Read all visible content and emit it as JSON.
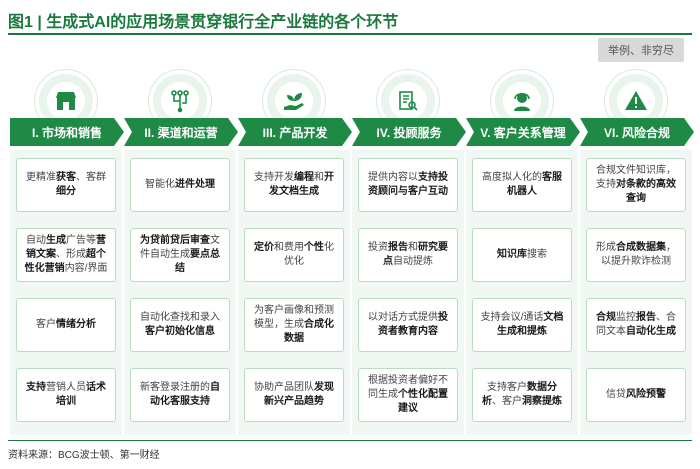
{
  "title": "图1 | 生成式AI的应用场景贯穿银行全产业链的各个环节",
  "badge": "举例、非穷尽",
  "source": "资料来源：BCG波士顿、第一财经",
  "colors": {
    "green": "#1e8a46",
    "light": "#f1f7f2",
    "border": "#b9dcc3"
  },
  "columns": [
    {
      "label": "I. 市场和销售",
      "icon": "store-icon",
      "cells": [
        [
          {
            "t": "更精准"
          },
          {
            "t": "获客",
            "b": true
          },
          {
            "t": "、客群"
          },
          {
            "t": "细分",
            "b": true
          }
        ],
        [
          {
            "t": "自动"
          },
          {
            "t": "生成",
            "b": true
          },
          {
            "t": "广告等"
          },
          {
            "t": "营销文案",
            "b": true
          },
          {
            "t": "、形成"
          },
          {
            "t": "超个性化营销",
            "b": true
          },
          {
            "t": "内容/界面"
          }
        ],
        [
          {
            "t": "客户"
          },
          {
            "t": "情绪分析",
            "b": true
          }
        ],
        [
          {
            "t": "支持",
            "b": true
          },
          {
            "t": "营销人员"
          },
          {
            "t": "话术培训",
            "b": true
          }
        ]
      ]
    },
    {
      "label": "II. 渠道和运营",
      "icon": "circuit-icon",
      "cells": [
        [
          {
            "t": "智能化"
          },
          {
            "t": "进件处理",
            "b": true
          }
        ],
        [
          {
            "t": "为",
            "b": true
          },
          {
            "t": "贷前贷后审查",
            "b": true
          },
          {
            "t": "文件自动生成"
          },
          {
            "t": "要点总结",
            "b": true
          }
        ],
        [
          {
            "t": "自动化查找和录入"
          },
          {
            "t": "客户初始化信息",
            "b": true
          }
        ],
        [
          {
            "t": "新客登录注册的"
          },
          {
            "t": "自动化客服支持",
            "b": true
          }
        ]
      ]
    },
    {
      "label": "III. 产品开发",
      "icon": "plant-hand-icon",
      "cells": [
        [
          {
            "t": "支持开发"
          },
          {
            "t": "编程",
            "b": true
          },
          {
            "t": "和"
          },
          {
            "t": "开发文档生成",
            "b": true
          }
        ],
        [
          {
            "t": "定价",
            "b": true
          },
          {
            "t": "和费用"
          },
          {
            "t": "个性",
            "b": true
          },
          {
            "t": "化优化"
          }
        ],
        [
          {
            "t": "为客户画像和预测模型，生成"
          },
          {
            "t": "合成化数据",
            "b": true
          }
        ],
        [
          {
            "t": "协助产品团队"
          },
          {
            "t": "发现新兴产品趋势",
            "b": true
          }
        ]
      ]
    },
    {
      "label": "IV. 投顾服务",
      "icon": "document-search-icon",
      "cells": [
        [
          {
            "t": "提供内容以"
          },
          {
            "t": "支持投资顾问与客户互动",
            "b": true
          }
        ],
        [
          {
            "t": "投资"
          },
          {
            "t": "报告",
            "b": true
          },
          {
            "t": "和"
          },
          {
            "t": "研究要点",
            "b": true
          },
          {
            "t": "自动提炼"
          }
        ],
        [
          {
            "t": "以对话方式提供"
          },
          {
            "t": "投资者教育内容",
            "b": true
          }
        ],
        [
          {
            "t": "根据投资者偏好不同生成"
          },
          {
            "t": "个性化配置建议",
            "b": true
          }
        ]
      ]
    },
    {
      "label": "V. 客户关系管理",
      "icon": "headset-icon",
      "cells": [
        [
          {
            "t": "高度拟人化的"
          },
          {
            "t": "客服机器人",
            "b": true
          }
        ],
        [
          {
            "t": "知识库",
            "b": true
          },
          {
            "t": "搜索"
          }
        ],
        [
          {
            "t": "支持会议/通话"
          },
          {
            "t": "文档生成和提炼",
            "b": true
          }
        ],
        [
          {
            "t": "支持客户"
          },
          {
            "t": "数据分析",
            "b": true
          },
          {
            "t": "、客户"
          },
          {
            "t": "洞察提炼",
            "b": true
          }
        ]
      ]
    },
    {
      "label": "VI. 风险合规",
      "icon": "warning-icon",
      "cells": [
        [
          {
            "t": "合规文件知识库，支持"
          },
          {
            "t": "对条款的高效查询",
            "b": true
          }
        ],
        [
          {
            "t": "形成"
          },
          {
            "t": "合成数据集",
            "b": true
          },
          {
            "t": "，以提升欺诈检测"
          }
        ],
        [
          {
            "t": "合规",
            "b": true
          },
          {
            "t": "监控"
          },
          {
            "t": "报告",
            "b": true
          },
          {
            "t": "、合同文本"
          },
          {
            "t": "自动化生成",
            "b": true
          }
        ],
        [
          {
            "t": "信贷"
          },
          {
            "t": "风险预警",
            "b": true
          }
        ]
      ]
    }
  ]
}
